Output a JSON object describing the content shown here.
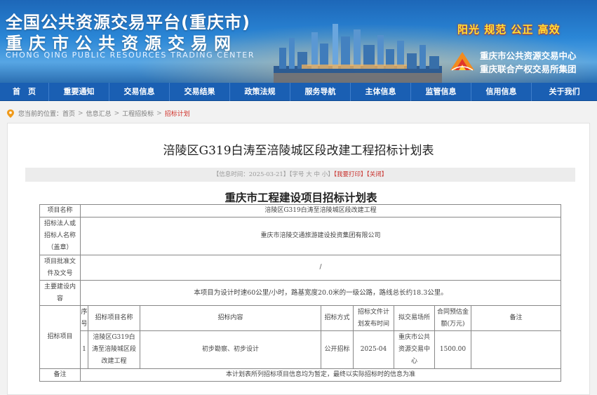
{
  "header": {
    "title_line1": "全国公共资源交易平台(重庆市)",
    "title_line2": "重庆市公共资源交易网",
    "title_en": "CHONG QING PUBLIC RESOURCES TRADING CENTER",
    "slogan": "阳光 规范 公正 高效",
    "org_line1": "重庆市公共资源交易中心",
    "org_line2": "重庆联合产权交易所集团",
    "logo_icon": "exchange-logo-icon"
  },
  "nav": [
    {
      "label": "首　页"
    },
    {
      "label": "重要通知"
    },
    {
      "label": "交易信息"
    },
    {
      "label": "交易结果"
    },
    {
      "label": "政策法规"
    },
    {
      "label": "服务导航"
    },
    {
      "label": "主体信息"
    },
    {
      "label": "监管信息"
    },
    {
      "label": "信用信息"
    },
    {
      "label": "关于我们"
    }
  ],
  "breadcrumb": {
    "prefix": "您当前的位置：",
    "items": [
      "首页",
      "信息汇总",
      "工程招投标",
      "招标计划"
    ],
    "separator": ">"
  },
  "article": {
    "title": "涪陵区G319白涛至涪陵城区段改建工程招标计划表",
    "info_bar": {
      "date_label": "【信息时间：2025-03-21】",
      "font_label": "【字号",
      "font_large": "大",
      "font_medium": "中",
      "font_small": "小】",
      "print": "【我要打印】",
      "close": "【关闭】"
    }
  },
  "plan_table": {
    "title": "重庆市工程建设项目招标计划表",
    "project_name_label": "项目名称",
    "project_name": "涪陵区G319白涛至涪陵城区段改建工程",
    "tenderer_label": "招标法人或招标人名称（盖章）",
    "tenderer": "重庆市涪陵交通旅游建设投资集团有限公司",
    "approval_label": "项目批准文件及文号",
    "approval": "/",
    "content_label": "主要建设内容",
    "content": "本项目为设计时速60公里/小时，路基宽度20.0米的一级公路，路线总长约18.3公里。",
    "items_label": "招标项目",
    "columns": [
      "序号",
      "招标项目名称",
      "招标内容",
      "招标方式",
      "招标文件计划发布时间",
      "拟交易场所",
      "合同预估金额(万元)",
      "备注"
    ],
    "rows": [
      {
        "no": "1",
        "name": "涪陵区G319白涛至涪陵城区段改建工程",
        "content": "初步勘察、初步设计",
        "method": "公开招标",
        "release_time": "2025-04",
        "venue": "重庆市公共资源交易中心",
        "amount": "1500.00",
        "remark": ""
      }
    ],
    "remark_label": "备注",
    "remark": "本计划表所列招标项目信息均为暂定，最终以实际招标时的信息为准"
  },
  "colors": {
    "banner_blue": "#2a86d6",
    "nav_blue": "#1a5fb3",
    "slogan_yellow": "#ffe23a",
    "highlight_red": "#c9302c"
  }
}
